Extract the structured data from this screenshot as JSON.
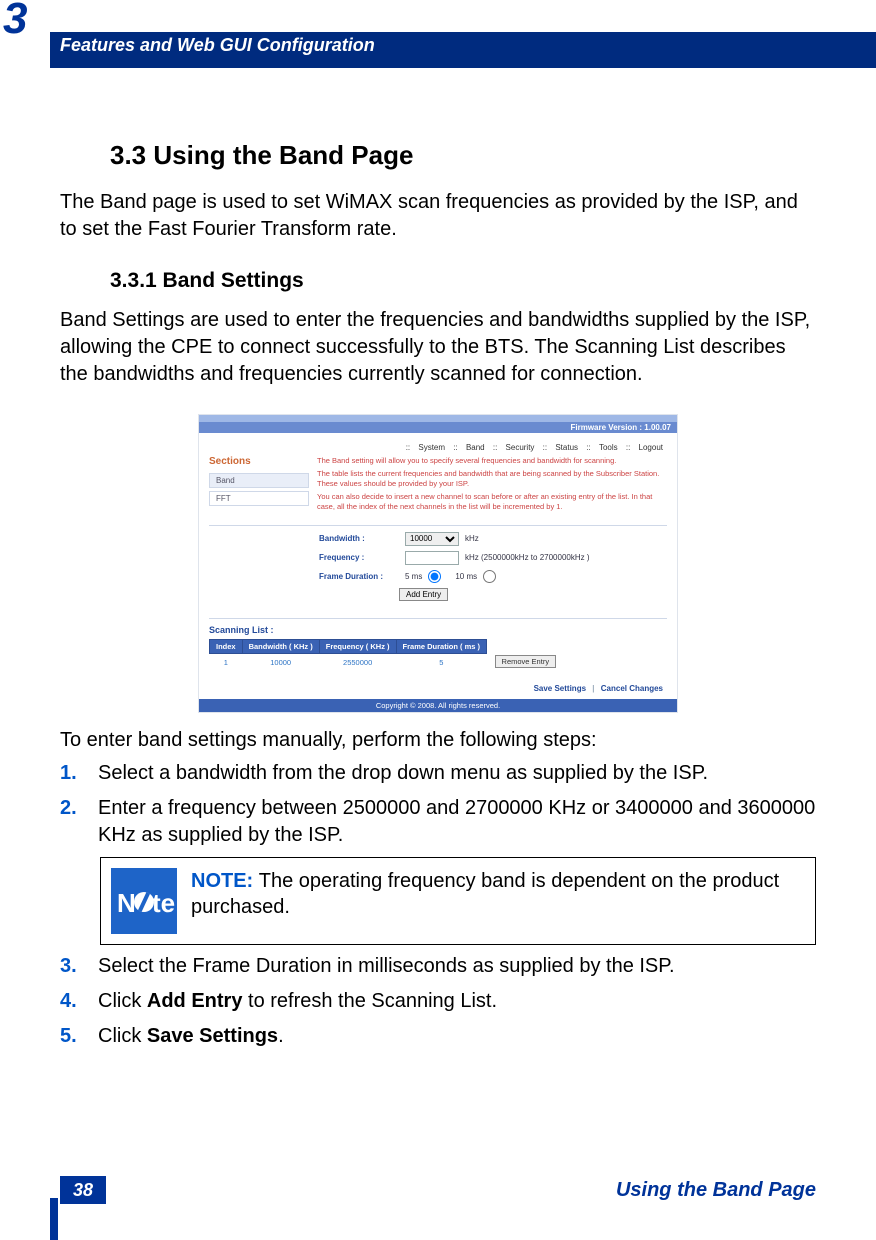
{
  "chapter_number": "3",
  "header": "Features and Web GUI Configuration",
  "section_heading": "3.3 Using the Band Page",
  "section_intro": "The Band page is used to set WiMAX scan frequencies as provided by the ISP, and to set the Fast Fourier Transform rate.",
  "subsection_heading": "3.3.1 Band Settings",
  "subsection_body": "Band Settings are used to enter the frequencies and bandwidths supplied by the ISP, allowing the CPE to connect successfully to the BTS. The Scanning List describes the bandwidths and frequencies currently scanned for connection.",
  "figure": {
    "firmware_version": "Firmware Version : 1.00.07",
    "nav": [
      "System",
      "Band",
      "Security",
      "Status",
      "Tools",
      "Logout"
    ],
    "sections_label": "Sections",
    "side_items": [
      "Band",
      "FFT"
    ],
    "desc1": "The Band setting will allow you to specify several frequencies and bandwidth for scanning.",
    "desc2": "The table lists the current frequencies and bandwidth that are being scanned by the Subscriber Station. These values should be provided by your ISP.",
    "desc3": "You can also decide to insert a new channel to scan before or after an existing entry of the list. In that case, all the index of the next channels in the list will be incremented by 1.",
    "bw_label": "Bandwidth :",
    "bw_value": "10000",
    "bw_unit": "kHz",
    "fq_label": "Frequency :",
    "fq_value": "",
    "fq_unit": "kHz  (2500000kHz to 2700000kHz )",
    "fd_label": "Frame Duration :",
    "fd_opt1": "5 ms",
    "fd_opt2": "10 ms",
    "add_btn": "Add Entry",
    "scan_heading": "Scanning List :",
    "th_index": "Index",
    "th_bw": "Bandwidth ( KHz )",
    "th_fq": "Frequency ( KHz )",
    "th_fd": "Frame Duration ( ms )",
    "row": {
      "index": "1",
      "bw": "10000",
      "fq": "2550000",
      "fd": "5"
    },
    "remove_btn": "Remove Entry",
    "save": "Save Settings",
    "cancel": "Cancel Changes",
    "copyright": "Copyright © 2008. All rights reserved."
  },
  "steps_intro": "To enter band settings manually, perform the following steps:",
  "steps": {
    "s1": "Select a bandwidth from the drop down menu as supplied by the ISP.",
    "s2": "Enter a frequency between 2500000 and 2700000 KHz or 3400000 and 3600000 KHz as supplied by the ISP.",
    "s3": "Select the Frame Duration in milliseconds as supplied by the ISP.",
    "s4_prefix": "Click ",
    "s4_bold": "Add Entry",
    "s4_suffix": " to refresh the Scanning List.",
    "s5_prefix": "Click ",
    "s5_bold": "Save Settings",
    "s5_suffix": "."
  },
  "note": {
    "label": "NOTE: ",
    "body": "The operating frequency band is dependent on the product purchased."
  },
  "page_number": "38",
  "footer_title": "Using the Band Page"
}
